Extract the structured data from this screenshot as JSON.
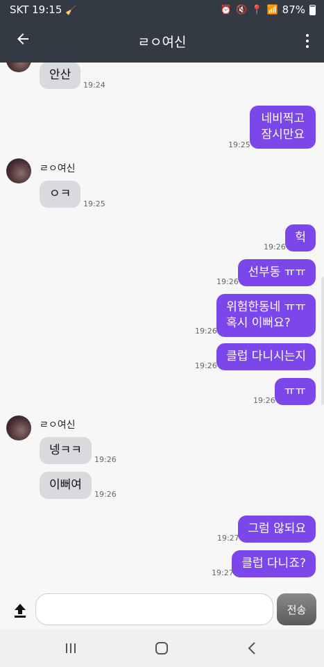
{
  "status": {
    "carrier": "SKT",
    "time": "19:15",
    "battery": "87%"
  },
  "header": {
    "title": "ㄹㅇ여신"
  },
  "messages": [
    {
      "dir": "in",
      "text": "안산",
      "time": "19:24"
    },
    {
      "dir": "out",
      "text": "네비찍고\n잠시만요",
      "time": "19:25"
    },
    {
      "dir": "in",
      "sender": "ㄹㅇ여신",
      "text": "ㅇㅋ",
      "time": "19:25"
    },
    {
      "dir": "out",
      "text": "헉",
      "time": "19:26"
    },
    {
      "dir": "out",
      "text": "선부동 ㅠㅠ",
      "time": "19:26"
    },
    {
      "dir": "out",
      "text": "위험한동네 ㅠㅠ\n혹시 이뻐요?",
      "time": "19:26"
    },
    {
      "dir": "out",
      "text": "클럽 다니시는지",
      "time": "19:26"
    },
    {
      "dir": "out",
      "text": "ㅠㅠ",
      "time": "19:26"
    },
    {
      "dir": "in",
      "sender": "ㄹㅇ여신",
      "text": "넹ㅋㅋ",
      "time": "19:26"
    },
    {
      "dir": "in",
      "text": "이뻐여",
      "time": "19:26"
    },
    {
      "dir": "out",
      "text": "그럼 않되요",
      "time": "19:27"
    },
    {
      "dir": "out",
      "text": "클럽 다니죠?",
      "time": "19:27"
    }
  ],
  "composer": {
    "placeholder": "",
    "send_label": "전송"
  }
}
